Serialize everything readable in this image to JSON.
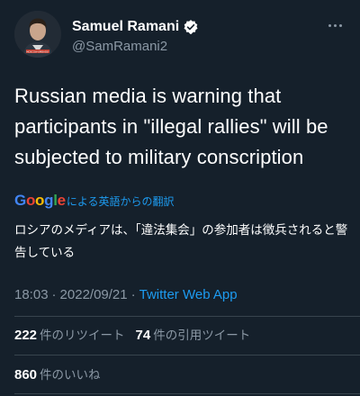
{
  "author": {
    "display_name": "Samuel Ramani",
    "handle": "@SamRamani2",
    "avatar_caption": "MOSCOW EMBASSY"
  },
  "tweet": {
    "text": "Russian media is warning that participants in \"illegal rallies\" will be subjected to military conscription"
  },
  "translation": {
    "label": "による英語からの翻訳",
    "text": "ロシアのメディアは、「違法集会」の参加者は徴兵されると警告している"
  },
  "meta": {
    "time": "18:03",
    "date": "2022/09/21",
    "separator": "·",
    "source": "Twitter Web App"
  },
  "stats": {
    "retweets_count": "222",
    "retweets_label": "件のリツイート",
    "quotes_count": "74",
    "quotes_label": "件の引用ツイート",
    "likes_count": "860",
    "likes_label": "件のいいね"
  },
  "colors": {
    "background": "#15202b",
    "accent": "#1d9bf0",
    "secondary_text": "#8b98a5",
    "divider": "#38444d"
  }
}
